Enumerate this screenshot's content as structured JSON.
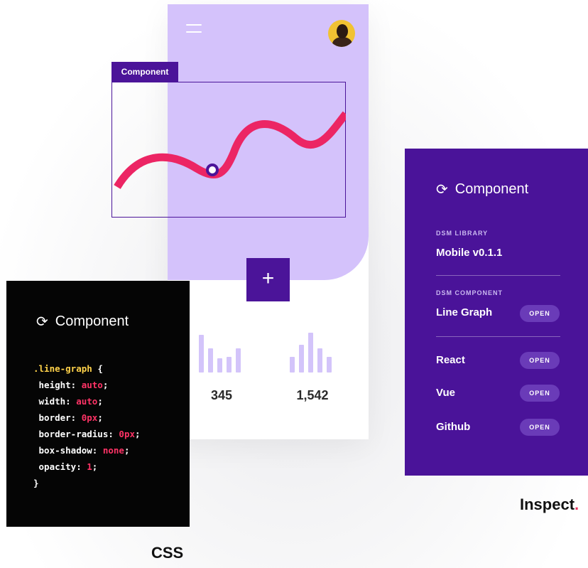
{
  "phone": {
    "stats": [
      {
        "value": "345",
        "bars": [
          0.95,
          0.6,
          0.35,
          0.4,
          0.6
        ]
      },
      {
        "value": "1,542",
        "bars": [
          0.4,
          0.7,
          1.0,
          0.6,
          0.4
        ]
      }
    ],
    "add_label": "+",
    "bar_color": "#d3c4fa",
    "accent": "#4b1499",
    "background": "#d4c2fb"
  },
  "overlay": {
    "tag": "Component",
    "line_color": "#ec2564"
  },
  "css_panel": {
    "title": "Component",
    "code": {
      "selector": ".line-graph",
      "open": "{",
      "close": "}",
      "properties": [
        {
          "name": "height",
          "value": "auto"
        },
        {
          "name": "width",
          "value": "auto"
        },
        {
          "name": "border",
          "value": "0px"
        },
        {
          "name": "border-radius",
          "value": "0px"
        },
        {
          "name": "box-shadow",
          "value": "none"
        },
        {
          "name": "opacity",
          "value": "1"
        }
      ]
    },
    "caption": "CSS"
  },
  "inspect_panel": {
    "title": "Component",
    "library_label": "DSM LIBRARY",
    "library_value": "Mobile v0.1.1",
    "component_label": "DSM COMPONENT",
    "component_value": "Line Graph",
    "open_label": "OPEN",
    "links": [
      "React",
      "Vue",
      "Github"
    ],
    "background": "#4a1399"
  },
  "brand": {
    "word": "Inspect",
    "dot": "."
  }
}
